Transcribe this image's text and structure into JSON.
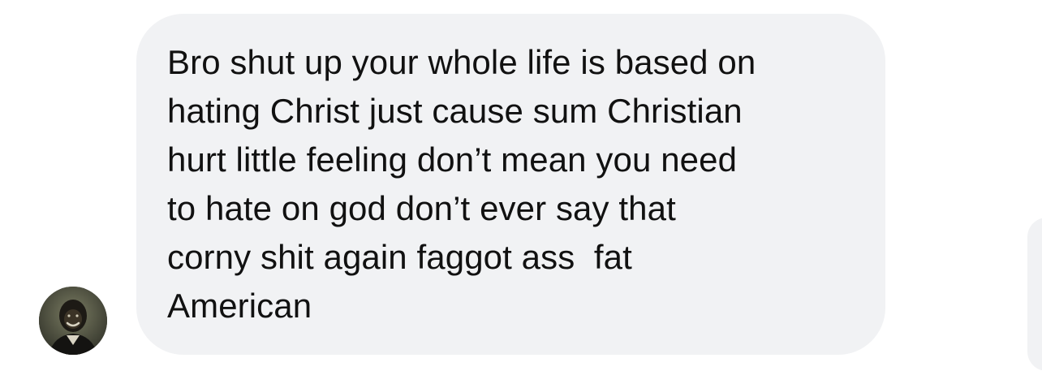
{
  "conversation": {
    "incoming_message": {
      "lines": [
        "Bro shut up your whole life is based on",
        "hating Christ just cause sum Christian",
        "hurt little feeling don’t mean you need",
        "to hate on god don’t ever say that",
        "corny shit again faggot ass  fat",
        "American"
      ]
    },
    "avatar": {
      "icon": "user-photo-avatar"
    }
  },
  "colors": {
    "bubble_background": "#f1f2f4",
    "text": "#111111",
    "page_background": "#ffffff"
  }
}
